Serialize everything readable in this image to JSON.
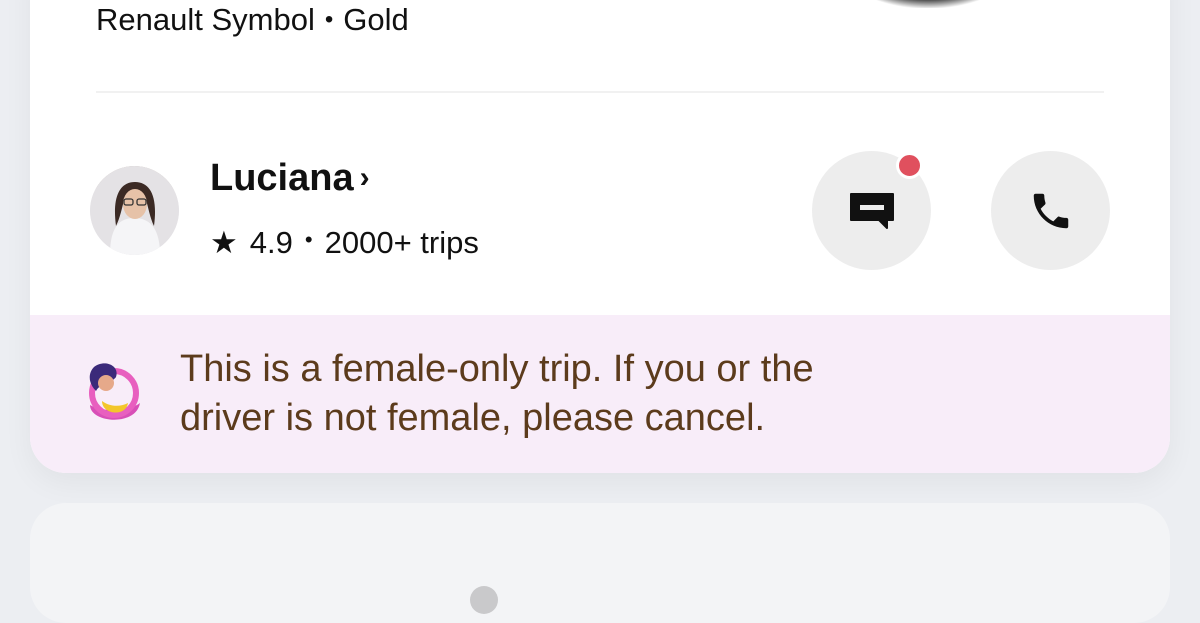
{
  "vehicle": {
    "model": "Renault Symbol",
    "separator": "•",
    "color": "Gold"
  },
  "driver": {
    "name": "Luciana",
    "chevron": "›",
    "star_glyph": "★",
    "rating": "4.9",
    "separator": "•",
    "trips": "2000+ trips"
  },
  "actions": {
    "message_icon": "message-icon",
    "call_icon": "phone-icon",
    "has_unread": true,
    "unread_color": "#e0505e"
  },
  "notice": {
    "text": "This is a female-only trip. If you or the\ndriver is not female, please cancel.",
    "background": "#f8edf9",
    "text_color": "#5c3b1c"
  },
  "next_card": {
    "label": "",
    "price": ""
  },
  "colors": {
    "accent_price": "#2f6fe0",
    "button_bg": "#ededed"
  }
}
